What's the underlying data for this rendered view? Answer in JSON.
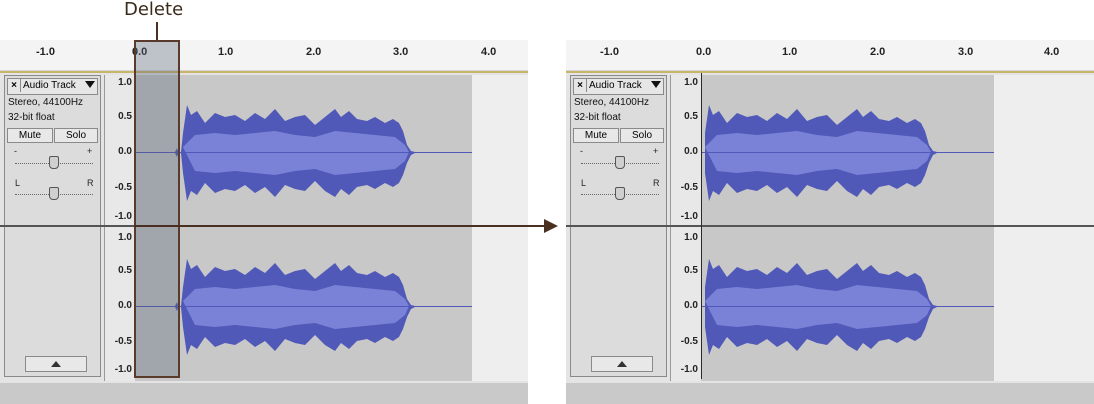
{
  "annotation": {
    "label": "Delete"
  },
  "ruler": {
    "ticks": [
      "-1.0",
      "0.0",
      "1.0",
      "2.0",
      "3.0",
      "4.0"
    ]
  },
  "track": {
    "name": "Audio Track",
    "format": "Stereo, 44100Hz",
    "bit_depth": "32-bit float",
    "mute_label": "Mute",
    "solo_label": "Solo",
    "gain_minus": "-",
    "gain_plus": "+",
    "pan_left": "L",
    "pan_right": "R",
    "close_symbol": "×"
  },
  "vertical_scale": [
    "1.0",
    "0.5",
    "0.0",
    "-0.5",
    "-1.0"
  ],
  "colors": {
    "waveform": "#5058b8",
    "waveform_rms": "#7a82d8",
    "selection_border": "#5a3a2a",
    "arrow": "#4a3020"
  },
  "icons": [
    "close-icon",
    "dropdown-arrow-icon",
    "collapse-arrow-icon",
    "right-arrow-icon"
  ]
}
